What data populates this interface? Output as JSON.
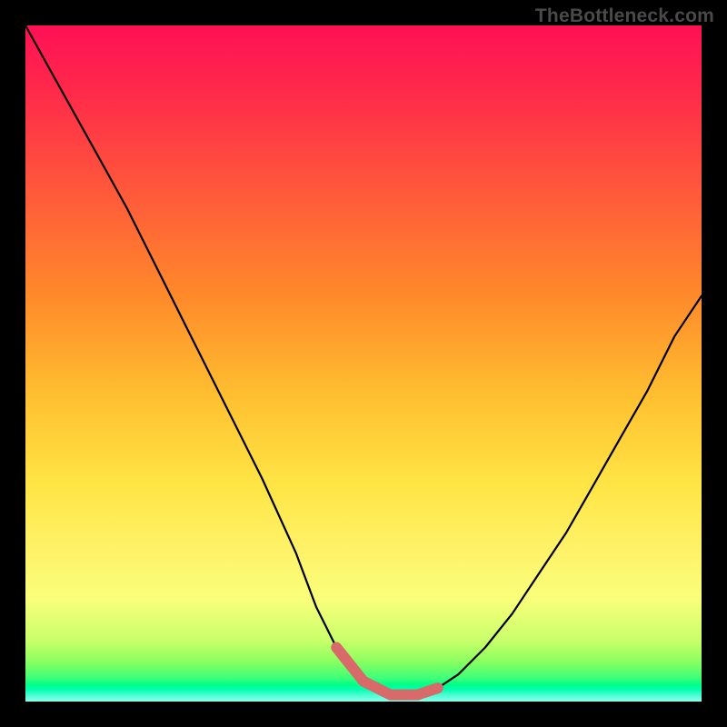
{
  "watermark": "TheBottleneck.com",
  "colors": {
    "page_bg": "#000000",
    "gradient_top": "#ff1055",
    "gradient_mid1": "#ff8a2a",
    "gradient_mid2": "#ffe545",
    "gradient_bottom": "#00ff88",
    "curve_stroke": "#000000",
    "trough_stroke": "#d86a6a"
  },
  "chart_data": {
    "type": "line",
    "title": "",
    "xlabel": "",
    "ylabel": "",
    "xlim": [
      0,
      100
    ],
    "ylim": [
      0,
      100
    ],
    "grid": false,
    "series": [
      {
        "name": "curve",
        "x": [
          0,
          5,
          10,
          15,
          20,
          25,
          30,
          35,
          40,
          43,
          46,
          50,
          54,
          58,
          61,
          64,
          68,
          72,
          76,
          80,
          84,
          88,
          92,
          96,
          100
        ],
        "values": [
          100,
          91,
          82,
          73,
          63,
          53,
          43,
          33,
          22,
          14,
          8,
          3,
          1,
          1,
          2,
          4,
          8,
          13,
          19,
          25,
          32,
          39,
          46,
          54,
          60
        ]
      }
    ],
    "trough_region": {
      "x_start": 46,
      "x_end": 62
    },
    "annotations": []
  }
}
